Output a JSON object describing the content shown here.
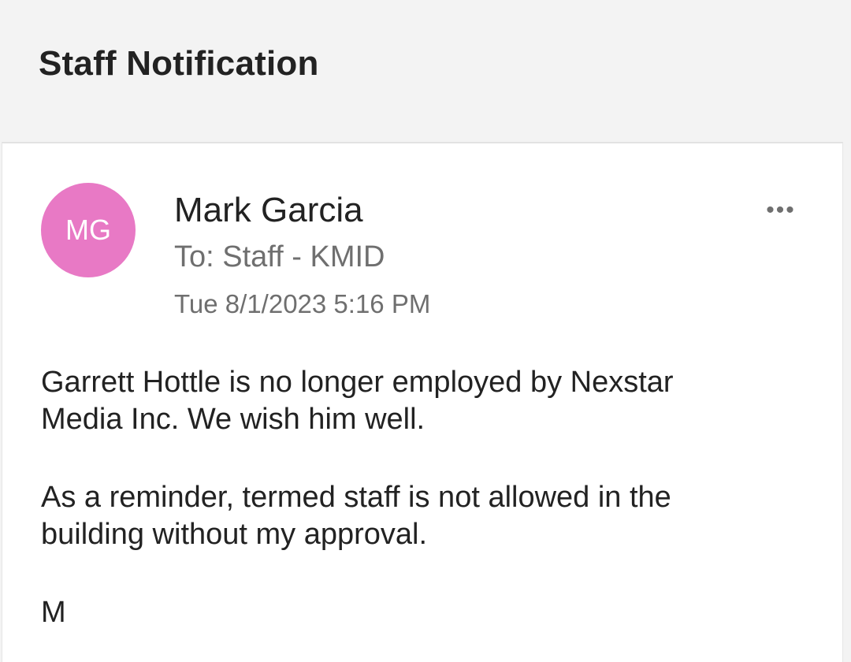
{
  "header": {
    "subject": "Staff Notification"
  },
  "message": {
    "avatar_initials": "MG",
    "avatar_color": "#e879c5",
    "sender": "Mark Garcia",
    "recipients": "To: Staff - KMID",
    "date": "Tue 8/1/2023 5:16 PM",
    "more_icon": "•••",
    "body": {
      "p1_line1": "Garrett Hottle is no longer employed by Nexstar",
      "p1_line2": "Media Inc. We wish him well.",
      "p2_line1": "As a reminder, termed staff is not allowed in the",
      "p2_line2": "building without my approval.",
      "signature": "M"
    }
  }
}
